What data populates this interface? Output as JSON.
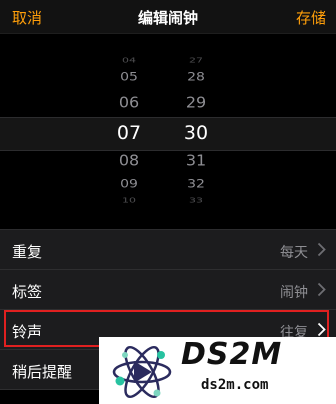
{
  "nav": {
    "cancel_label": "取消",
    "title": "编辑闹钟",
    "save_label": "存储"
  },
  "picker": {
    "hours": [
      "04",
      "05",
      "06",
      "07",
      "08",
      "09",
      "10"
    ],
    "minutes": [
      "27",
      "28",
      "29",
      "30",
      "31",
      "32",
      "33"
    ],
    "selected_hour": "07",
    "selected_minute": "30"
  },
  "settings": {
    "items": [
      {
        "label": "重复",
        "value": "每天"
      },
      {
        "label": "标签",
        "value": "闹钟"
      },
      {
        "label": "铃声",
        "value": "往复"
      },
      {
        "label": "稍后提醒",
        "value": ""
      }
    ]
  },
  "watermark": {
    "brand": "DS2M",
    "domain": "ds2m.com"
  },
  "colors": {
    "accent": "#ff9f0a",
    "highlight": "#e02020",
    "background": "#000000",
    "cell": "#1c1c1e",
    "secondary_text": "#8e8e93"
  },
  "icons": {
    "chevron": "chevron-right-icon",
    "logo": "atom-logo-icon"
  }
}
